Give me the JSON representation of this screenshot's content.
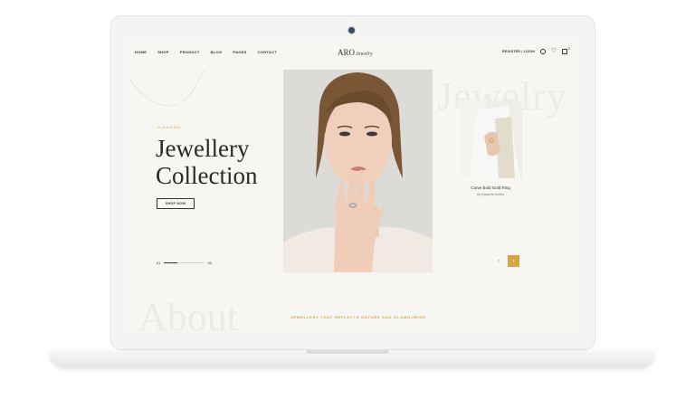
{
  "nav": {
    "items": [
      "HOME",
      "SHOP",
      "PRODUCT",
      "BLOG",
      "PAGES",
      "CONTACT"
    ],
    "logo_main": "ARO",
    "logo_script": "Jewelry",
    "login": "REGISTER / LOGIN",
    "cart_count": "0"
  },
  "hero": {
    "eyebrow": "DIAMOND",
    "title_line1": "Jewellery",
    "title_line2": "Collection",
    "button": "SHOP NOW",
    "slide_current": "01",
    "slide_total": "03",
    "progress": 0.33
  },
  "side": {
    "ghost_title": "Jewelry",
    "product_name": "Curve Bold Gold Ring",
    "product_author": "By Natasha Hollen"
  },
  "pager": {
    "prev": "‹",
    "next": "›"
  },
  "footer": {
    "ghost_title": "About",
    "tagline": "JEWELLERY THAT REFLECTS NATURE AND GLAMOURING"
  },
  "colors": {
    "accent": "#d6a441",
    "text": "#2a2a2a",
    "background": "#f7f6f3"
  },
  "icons": [
    "search-icon",
    "heart-icon",
    "cart-icon"
  ]
}
